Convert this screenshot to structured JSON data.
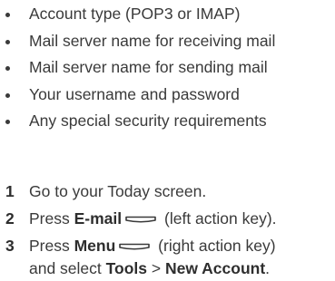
{
  "bullets": [
    "Account type (POP3 or IMAP)",
    "Mail server name for receiving mail",
    "Mail server name for sending mail",
    "Your username and password",
    "Any special security requirements"
  ],
  "steps": {
    "step1": {
      "number": "1",
      "text": "Go to your Today screen."
    },
    "step2": {
      "number": "2",
      "prefix": "Press ",
      "key_label": "E-mail",
      "icon": "left-action-key-icon",
      "suffix": " (left action key)."
    },
    "step3": {
      "number": "3",
      "prefix": "Press ",
      "key_label": "Menu",
      "icon": "right-action-key-icon",
      "suffix": " (right action key)",
      "line2_prefix": "and select ",
      "menu_item": "Tools",
      "separator": " > ",
      "submenu_item": "New Account",
      "line2_suffix": "."
    }
  }
}
